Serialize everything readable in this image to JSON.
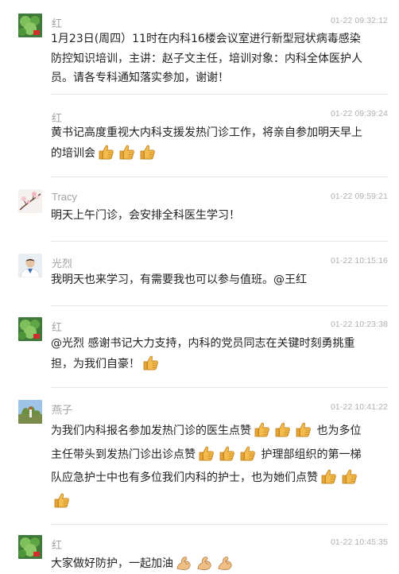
{
  "messages": [
    {
      "author": "红",
      "time": "01-22 09:32:12",
      "text": "1月23日(周四）11时在内科16楼会议室进行新型冠状病毒感染防控知识培训，主讲：赵子文主任，培训对象：内科全体医护人员。请各专科通知落实参加，谢谢！",
      "emoji": []
    },
    {
      "author": "红",
      "time": "01-22 09:39:24",
      "text": "黄书记高度重视大内科支援发热门诊工作，将亲自参加明天早上的培训会",
      "emoji": [
        "thumbs-up",
        "thumbs-up",
        "thumbs-up"
      ]
    },
    {
      "author": "Tracy",
      "time": "01-22 09:59:21",
      "text": "明天上午门诊，会安排全科医生学习！",
      "emoji": []
    },
    {
      "author": "光烈",
      "time": "01-22 10:15:16",
      "text": "我明天也来学习，有需要我也可以参与值班。@王红",
      "emoji": []
    },
    {
      "author": "红",
      "time": "01-22 10:23:38",
      "text": "@光烈 感谢书记大力支持，内科的党员同志在关键时刻勇挑重担，为我们自豪！",
      "emoji": [
        "thumbs-up"
      ]
    },
    {
      "author": "燕子",
      "time": "01-22 10:41:22",
      "segments": [
        "为我们内科报名参加发热门诊的医生点赞",
        "也为多位主任带头到发热门诊出诊点赞",
        "护理部组织的第一梯队应急护士中也有多位我们内科的护士，也为她们点赞"
      ]
    },
    {
      "author": "红",
      "time": "01-22 10:45:35",
      "text": "大家做好防护，一起加油",
      "emoji": [
        "flexed-biceps",
        "flexed-biceps",
        "flexed-biceps"
      ]
    }
  ],
  "icons": {
    "thumbs": "thumbs-up-icon",
    "biceps": "flexed-biceps-icon"
  },
  "colors": {
    "thumb": "#f2b545",
    "thumb_dark": "#c98a1f",
    "muscle": "#e8b37a",
    "muscle_dark": "#b9814c",
    "divider": "#e6e6e6"
  }
}
